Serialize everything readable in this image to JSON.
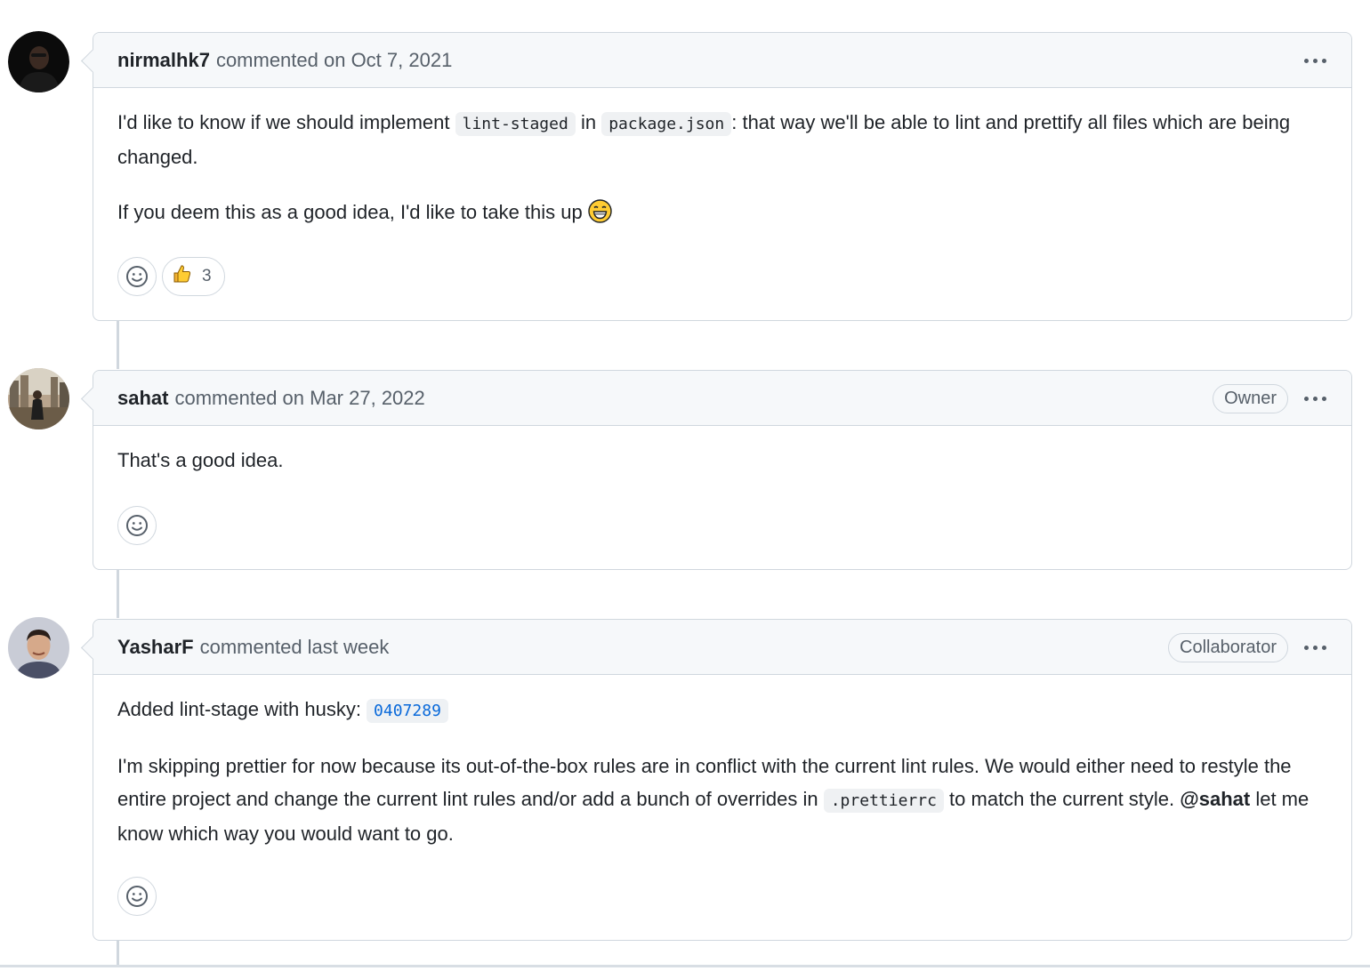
{
  "comments": [
    {
      "author": "nirmalhk7",
      "meta": "commented on Oct 7, 2021",
      "role": "",
      "body": {
        "p1_a": "I'd like to know if we should implement ",
        "p1_code1": "lint-staged",
        "p1_b": " in ",
        "p1_code2": "package.json",
        "p1_c": ": that way we'll be able to lint and prettify all files which are being changed.",
        "p2": "If you deem this as a good idea, I'd like to take this up "
      },
      "reactions": [
        {
          "icon": "thumbs-up-icon",
          "count": "3"
        }
      ]
    },
    {
      "author": "sahat",
      "meta": "commented on Mar 27, 2022",
      "role": "Owner",
      "body": {
        "p1": "That's a good idea."
      },
      "reactions": []
    },
    {
      "author": "YasharF",
      "meta": "commented last week",
      "role": "Collaborator",
      "body": {
        "p1_a": "Added lint-stage with husky: ",
        "p1_sha": "0407289",
        "p2_a": "I'm skipping prettier for now because its out-of-the-box rules are in conflict with the current lint rules. We would either need to restyle the entire project and change the current lint rules and/or add a bunch of overrides in ",
        "p2_code": ".prettierrc",
        "p2_b": " to match the current style. ",
        "p2_mention": "@sahat",
        "p2_c": " let me know which way you would want to go."
      },
      "reactions": []
    }
  ],
  "icons": {
    "add_reaction": "smiley-icon",
    "more_actions": "kebab-horizontal-icon",
    "inline_emoji": "grinning-face-icon"
  },
  "colors": {
    "header_bg": "#f6f8fa",
    "border": "#d0d7de",
    "muted_text": "#57606a",
    "link_blue": "#0969da"
  }
}
